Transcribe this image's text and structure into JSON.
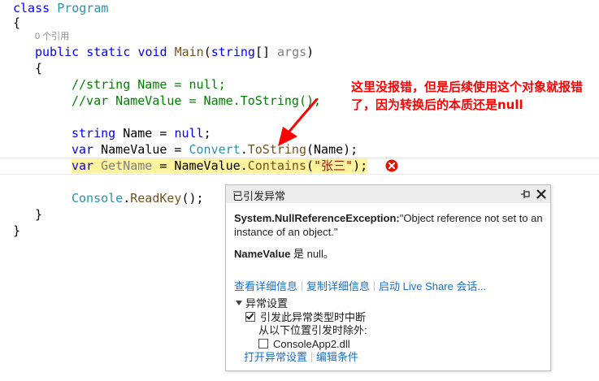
{
  "code": {
    "reference_count": "0 个引用",
    "lines": {
      "l1_kw": "class",
      "l1_cls": "Program",
      "l2": "{",
      "l4_kw1": "public",
      "l4_kw2": "static",
      "l4_kw3": "void",
      "l4_method": "Main",
      "l4_open": "(",
      "l4_type": "string",
      "l4_arr": "[] ",
      "l4_param": "args",
      "l4_close": ")",
      "l5": "{",
      "l6_comment": "//string Name = null;",
      "l7_comment": "//var NameValue = Name.ToString();",
      "l9_type": "string",
      "l9_rest": " Name = ",
      "l9_null": "null",
      "l9_end": ";",
      "l10_kw": "var",
      "l10_a": " NameValue = ",
      "l10_cls": "Convert",
      "l10_dot": ".",
      "l10_method": "ToString",
      "l10_b": "(Name);",
      "l11_kw": "var",
      "l11_sp": " ",
      "l11_var": "GetName",
      "l11_a": " = NameValue.",
      "l11_method": "Contains",
      "l11_open": "(",
      "l11_str": "\"张三\"",
      "l11_end": ");",
      "l13_cls": "Console",
      "l13_dot": ".",
      "l13_method": "ReadKey",
      "l13_end": "();",
      "l14": "}",
      "l15": "}"
    }
  },
  "annotation": {
    "text": "这里没报错，但是后续使用这个对象就报错了，因为转换后的本质还是null",
    "color": "#ff0000"
  },
  "exception_popup": {
    "title": "已引发异常",
    "exception_type": "System.NullReferenceException:",
    "exception_message": "\"Object reference not set to an instance of an object.\"",
    "null_var": "NameValue",
    "null_text": " 是 null。",
    "links": {
      "view_details": "查看详细信息",
      "copy_details": "复制详细信息",
      "live_share": "启动 Live Share 会话..."
    },
    "settings": {
      "title": "异常设置",
      "break_when_thrown": "引发此异常类型时中断",
      "except_when_from": "从以下位置引发时除外:",
      "module": "ConsoleApp2.dll",
      "break_checked": true,
      "module_checked": false
    },
    "bottom_links": {
      "open_settings": "打开异常设置",
      "edit_conditions": "编辑条件"
    }
  },
  "colors": {
    "keyword": "#0000ff",
    "class": "#2b91af",
    "comment": "#008000",
    "method": "#74531f",
    "string": "#a31515",
    "link": "#1a6ec9",
    "highlight": "#fff39d",
    "error": "#e51400"
  },
  "icons": [
    "error-icon",
    "pin-icon",
    "close-icon",
    "collapse-triangle-icon",
    "checkbox"
  ]
}
